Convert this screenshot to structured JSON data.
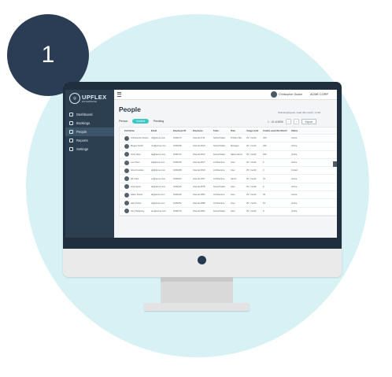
{
  "step": {
    "number": "1"
  },
  "colors": {
    "circle": "#d8f1f4",
    "badge": "#2b3d55",
    "sidebar": "#2b3f50",
    "accent": "#3cc9c3"
  },
  "app": {
    "logo_text": "UPFLEX",
    "logo_sub": "ENTERPRISE",
    "user_name": "Christopher Duane",
    "company": "ACME CORP"
  },
  "sidebar": {
    "items": [
      {
        "label": "Dashboard",
        "icon": "dashboard-icon"
      },
      {
        "label": "Bookings",
        "icon": "calendar-icon"
      },
      {
        "label": "People",
        "icon": "people-icon"
      },
      {
        "label": "Reports",
        "icon": "reports-icon"
      },
      {
        "label": "Settings",
        "icon": "gear-icon"
      }
    ]
  },
  "page": {
    "title": "People",
    "info": "Total Employees: used this month: 1,124",
    "tabs": [
      "Person",
      "Invited",
      "Pending"
    ],
    "pagination": "1 - 10 of 8096",
    "export_label": "Export"
  },
  "table": {
    "headers": [
      "Full Name",
      "Email",
      "Employee ID",
      "Employee",
      "Team",
      "Role",
      "Usage Limit",
      "Credits used this Month",
      "Status"
    ],
    "rows": [
      [
        "Christopher Duane",
        "cd@acme.com",
        "1000274",
        "Interval 4711",
        "Social Tasks",
        "Product Ma.",
        "25 / month",
        "320",
        "Active"
      ],
      [
        "Megan Smith",
        "ms@acme.com",
        "1000198",
        "Interval 4613",
        "Social Tasks",
        "Manager",
        "25 / month",
        "230",
        "Active"
      ],
      [
        "Andy Allen",
        "aa@acme.com",
        "1000473",
        "Interval 4612",
        "Social Tasks",
        "Sales Admin",
        "25 / month",
        "180",
        "Active"
      ],
      [
        "Leo Chen",
        "lc@acme.com",
        "1000219",
        "Interval 4617",
        "Architecture",
        "User",
        "25 / month",
        "0",
        "Active"
      ],
      [
        "Gina Knowles",
        "gk@acme.com",
        "1000238",
        "Interval 4619",
        "Architecture",
        "User",
        "25 / month",
        "0",
        "Invited"
      ],
      [
        "Ed Clark",
        "ec@acme.com",
        "1000224",
        "Interval 4627",
        "Architecture",
        "Admin",
        "25 / month",
        "15",
        "Active"
      ],
      [
        "Ana Harris",
        "ah@acme.com",
        "1000242",
        "Interval 4678",
        "Social Tasks",
        "User",
        "25 / month",
        "0",
        "Active"
      ],
      [
        "Adam Fisher",
        "af@acme.com",
        "1000249",
        "Interval 4653",
        "Architecture",
        "User",
        "25 / month",
        "45",
        "Active"
      ],
      [
        "Alex Torres",
        "at@acme.com",
        "1000252",
        "Interval 4688",
        "Architecture",
        "User",
        "25 / month",
        "15",
        "Active"
      ],
      [
        "Amy Mahoney",
        "am@acme.com",
        "1000270",
        "Interval 4694",
        "Social Tasks",
        "User",
        "25 / month",
        "0",
        "Active"
      ]
    ]
  }
}
